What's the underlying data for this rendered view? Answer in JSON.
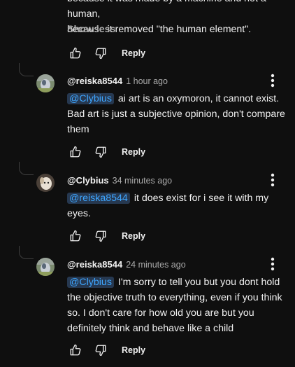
{
  "previous_comment": {
    "line_top": "because it was made by a machine and not a human,",
    "line_bottom": "because it removed \"the human element\".",
    "show_less_label": "Show less",
    "reply_label": "Reply"
  },
  "comments": [
    {
      "author": "@reiska8544",
      "time": "1 hour ago",
      "mention": "@Clybius",
      "text": "ai art is an oxymoron, it cannot exist. Bad art is just a subjective opinion, don't compare them",
      "reply_label": "Reply",
      "avatar": "avatar-icon"
    },
    {
      "author": "@Clybius",
      "time": "34 minutes ago",
      "mention": "@reiska8544",
      "text": "it does exist for i see it with my eyes.",
      "reply_label": "Reply",
      "avatar": "avatar-icon"
    },
    {
      "author": "@reiska8544",
      "time": "24 minutes ago",
      "mention": "@Clybius",
      "text": "I'm sorry to tell you but you dont hold the objective truth to everything, even if you think so. I don't care for how old you are but you definitely think and behave like a child",
      "reply_label": "Reply",
      "avatar": "avatar-icon"
    }
  ],
  "icons": {
    "like": "thumbs-up-icon",
    "dislike": "thumbs-down-icon",
    "menu": "more-vertical-icon"
  },
  "colors": {
    "background": "#0f0f0f",
    "text": "#f1f1f1",
    "secondary_text": "#aaaaaa",
    "mention_text": "#3ea6ff",
    "mention_bg": "#263850"
  }
}
